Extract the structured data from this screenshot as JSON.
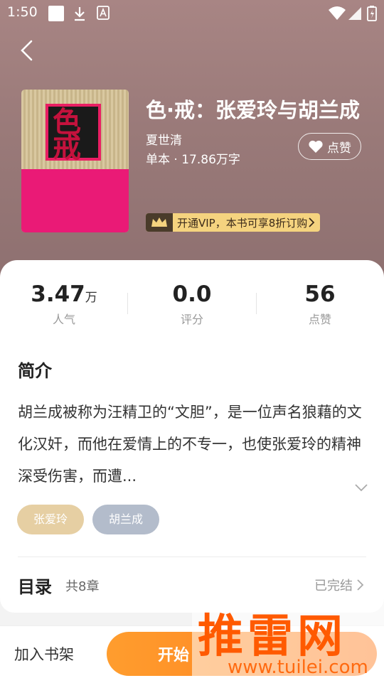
{
  "status_bar": {
    "time": "1:50"
  },
  "book": {
    "title": "色·戒：张爱玲与胡兰成",
    "author": "夏世清",
    "meta": "单本 · 17.86万字"
  },
  "like_button": {
    "label": "点赞"
  },
  "vip_banner": {
    "text": "开通VIP，本书可享8折订购"
  },
  "stats": [
    {
      "value": "3.47",
      "unit": "万",
      "label": "人气"
    },
    {
      "value": "0.0",
      "unit": "",
      "label": "评分"
    },
    {
      "value": "56",
      "unit": "",
      "label": "点赞"
    }
  ],
  "intro": {
    "heading": "简介",
    "text": "胡兰成被称为汪精卫的“文胆”，是一位声名狼藉的文化汉奸，而他在爱情上的不专一，也使张爱玲的精神深受伤害，而遭..."
  },
  "tags": [
    "张爱玲",
    "胡兰成"
  ],
  "toc": {
    "heading": "目录",
    "count": "共8章",
    "status": "已完结"
  },
  "bottom_bar": {
    "add_shelf": "加入书架",
    "start_label": "开始"
  },
  "watermark": {
    "title": "推雷网",
    "url": "www.tuilei.com"
  },
  "colors": {
    "accent": "#ff8a24",
    "hero": "#9a7a79",
    "tag1": "#e6cfa3",
    "tag2": "#b3bccb"
  }
}
